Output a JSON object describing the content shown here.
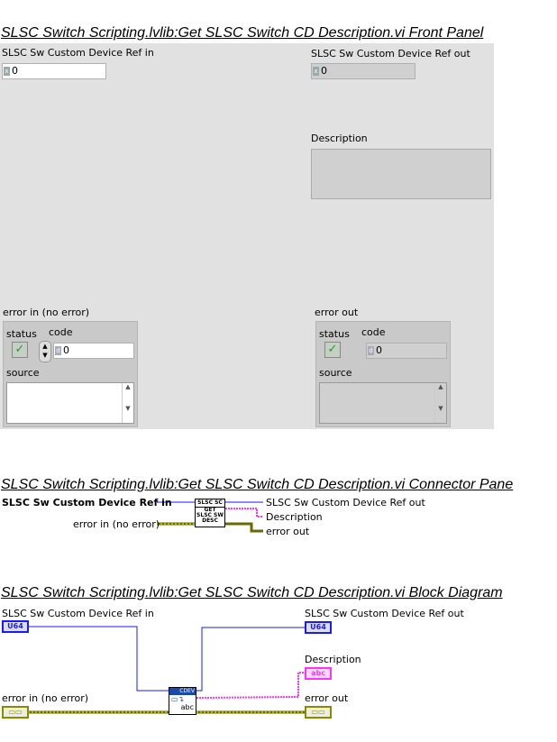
{
  "front_panel": {
    "title": "SLSC Switch Scripting.lvlib:Get SLSC Switch CD Description.vi Front Panel",
    "ref_in": {
      "label": "SLSC Sw Custom Device Ref in",
      "value": "0"
    },
    "ref_out": {
      "label": "SLSC Sw Custom Device Ref out",
      "value": "0"
    },
    "description": {
      "label": "Description",
      "value": ""
    },
    "error_in": {
      "label": "error in (no error)",
      "status_label": "status",
      "code_label": "code",
      "code": "0",
      "source_label": "source",
      "status_glyph": "✓"
    },
    "error_out": {
      "label": "error out",
      "status_label": "status",
      "code_label": "code",
      "code": "0",
      "source_label": "source",
      "status_glyph": "✓"
    }
  },
  "connector_pane": {
    "title": "SLSC Switch Scripting.lvlib:Get SLSC Switch CD Description.vi Connector Pane",
    "inputs": [
      "SLSC Sw Custom Device Ref in",
      "error in (no error)"
    ],
    "outputs": [
      "SLSC Sw Custom Device Ref out",
      "Description",
      "error out"
    ],
    "icon_top": "SLSC SC",
    "icon_text": "GET SLSC SW DESC"
  },
  "block_diagram": {
    "title": "SLSC Switch Scripting.lvlib:Get SLSC Switch CD Description.vi Block Diagram",
    "ref_in": "SLSC Sw Custom Device Ref in",
    "ref_out": "SLSC Sw Custom Device Ref out",
    "description": "Description",
    "error_in": "error in (no error)",
    "error_out": "error out",
    "u64": "U64",
    "abc": "abc",
    "node_top": "CDEV",
    "node_bottom": "abc"
  },
  "colors": {
    "ref": "#1a1aff",
    "string": "#ff33ff",
    "error": "#8a8a00"
  }
}
